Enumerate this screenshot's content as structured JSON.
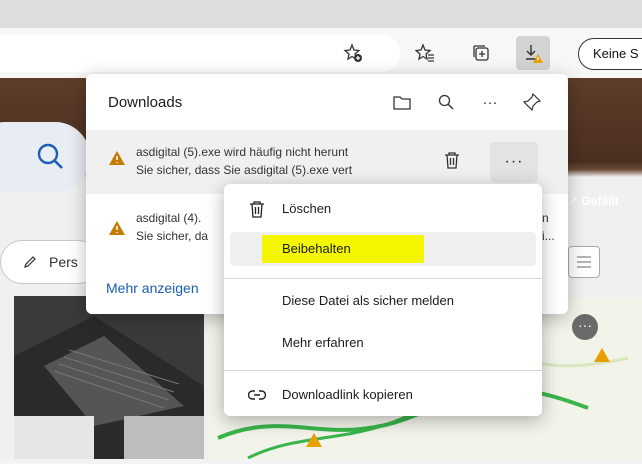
{
  "toolbar": {
    "keine_button_label": "Keine S"
  },
  "downloads_panel": {
    "title": "Downloads",
    "items": [
      {
        "line1": "asdigital (5).exe wird häufig nicht herunt",
        "line2": "Sie sicher, dass Sie asdigital (5).exe vert"
      },
      {
        "line1": "asdigital (4).",
        "line1_tail": "n",
        "line2": "Sie sicher, da",
        "line2_tail": "i..."
      }
    ],
    "more_link": "Mehr anzeigen"
  },
  "context_menu": {
    "items": [
      {
        "label": "Löschen",
        "icon": "trash-icon"
      },
      {
        "label": "Beibehalten"
      },
      {
        "label": "Diese Datei als sicher melden"
      },
      {
        "label": "Mehr erfahren"
      },
      {
        "label": "Downloadlink kopieren",
        "icon": "link-icon"
      }
    ]
  },
  "background": {
    "persona_chip": "Pers",
    "gefallt_label": "Gefällt"
  },
  "colors": {
    "highlight": "#f4f700",
    "link": "#1a5fb4",
    "warning": "#c77a00"
  }
}
